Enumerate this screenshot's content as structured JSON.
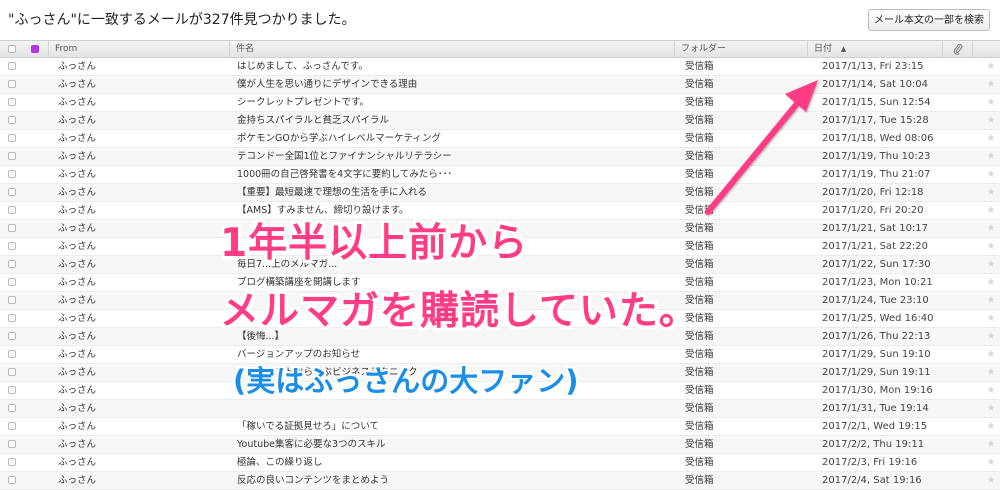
{
  "search": {
    "result_text": "\"ふっさん\"に一致するメールが327件見つかりました。",
    "body_search_button": "メール本文の一部を検索"
  },
  "table": {
    "headers": {
      "from": "From",
      "subject": "件名",
      "folder": "フォルダー",
      "date": "日付",
      "sort_indicator": "▲"
    },
    "rows": [
      {
        "from": "ふっさん",
        "subject": "はじめまして、ふっさんです。",
        "folder": "受信箱",
        "date": "2017/1/13, Fri 23:15"
      },
      {
        "from": "ふっさん",
        "subject": "僕が人生を思い通りにデザインできる理由",
        "folder": "受信箱",
        "date": "2017/1/14, Sat 10:04"
      },
      {
        "from": "ふっさん",
        "subject": "シークレットプレゼントです。",
        "folder": "受信箱",
        "date": "2017/1/15, Sun 12:54"
      },
      {
        "from": "ふっさん",
        "subject": "金持ちスパイラルと貧乏スパイラル",
        "folder": "受信箱",
        "date": "2017/1/17, Tue 15:28"
      },
      {
        "from": "ふっさん",
        "subject": "ポケモンGOから学ぶハイレベルマーケティング",
        "folder": "受信箱",
        "date": "2017/1/18, Wed 08:06"
      },
      {
        "from": "ふっさん",
        "subject": "テコンドー全国1位とファイナンシャルリテラシー",
        "folder": "受信箱",
        "date": "2017/1/19, Thu 10:23"
      },
      {
        "from": "ふっさん",
        "subject": "1000冊の自己啓発書を4文字に要約してみたら･･･",
        "folder": "受信箱",
        "date": "2017/1/19, Thu 21:07"
      },
      {
        "from": "ふっさん",
        "subject": "【重要】最短最速で理想の生活を手に入れる",
        "folder": "受信箱",
        "date": "2017/1/20, Fri 12:18"
      },
      {
        "from": "ふっさん",
        "subject": "【AMS】すみません、締切り設けます。",
        "folder": "受信箱",
        "date": "2017/1/20, Fri 20:20"
      },
      {
        "from": "ふっさん",
        "subject": "",
        "folder": "受信箱",
        "date": "2017/1/21, Sat 10:17"
      },
      {
        "from": "ふっさん",
        "subject": "",
        "folder": "受信箱",
        "date": "2017/1/21, Sat 22:20"
      },
      {
        "from": "ふっさん",
        "subject": "毎日7...上のメルマガ...",
        "folder": "受信箱",
        "date": "2017/1/22, Sun 17:30"
      },
      {
        "from": "ふっさん",
        "subject": "ブログ構築講座を開講します",
        "folder": "受信箱",
        "date": "2017/1/23, Mon 10:21"
      },
      {
        "from": "ふっさん",
        "subject": "",
        "folder": "受信箱",
        "date": "2017/1/24, Tue 23:10"
      },
      {
        "from": "ふっさん",
        "subject": "",
        "folder": "受信箱",
        "date": "2017/1/25, Wed 16:40"
      },
      {
        "from": "ふっさん",
        "subject": "【後悔...】",
        "folder": "受信箱",
        "date": "2017/1/26, Thu 22:13"
      },
      {
        "from": "ふっさん",
        "subject": "バージョンアップのお知らせ",
        "folder": "受信箱",
        "date": "2017/1/29, Sun 19:10"
      },
      {
        "from": "ふっさん",
        "subject": "ファンカストから学ぶビジネステクニック",
        "folder": "受信箱",
        "date": "2017/1/29, Sun 19:11"
      },
      {
        "from": "ふっさん",
        "subject": "",
        "folder": "受信箱",
        "date": "2017/1/30, Mon 19:16"
      },
      {
        "from": "ふっさん",
        "subject": "",
        "folder": "受信箱",
        "date": "2017/1/31, Tue 19:14"
      },
      {
        "from": "ふっさん",
        "subject": "「稼いでる証拠見せろ」について",
        "folder": "受信箱",
        "date": "2017/2/1, Wed 19:15"
      },
      {
        "from": "ふっさん",
        "subject": "Youtube集客に必要な3つのスキル",
        "folder": "受信箱",
        "date": "2017/2/2, Thu 19:11"
      },
      {
        "from": "ふっさん",
        "subject": "極論、この繰り返し",
        "folder": "受信箱",
        "date": "2017/2/3, Fri 19:16"
      },
      {
        "from": "ふっさん",
        "subject": "反応の良いコンテンツをまとめよう",
        "folder": "受信箱",
        "date": "2017/2/4, Sat 19:16"
      }
    ]
  },
  "overlay": {
    "line1": "1年半以上前から",
    "line2": "メルマガを購読していた。",
    "line3": "(実はふっさんの大ファン)",
    "pink_color": "#ff3c84",
    "blue_color": "#1b8ee8"
  },
  "icons": {
    "attachment": "paperclip-icon",
    "star": "star-icon",
    "flag": "purple-flag-icon"
  }
}
